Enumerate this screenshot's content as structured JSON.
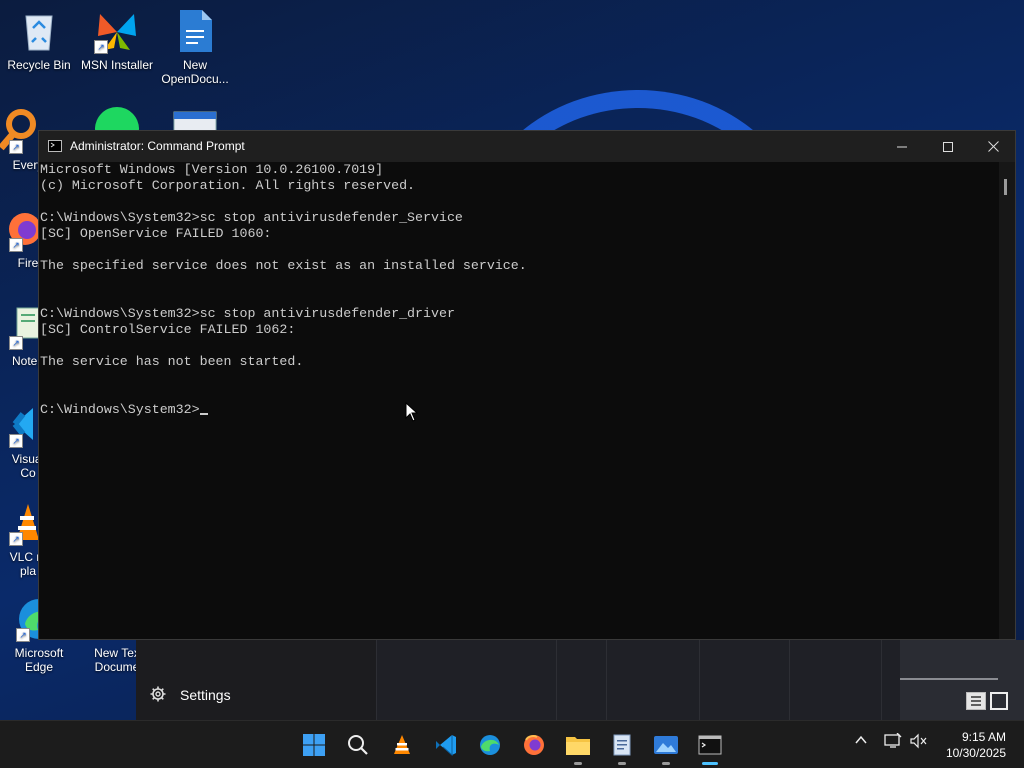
{
  "desktop": {
    "icons": [
      {
        "label": "Recycle Bin"
      },
      {
        "label": "MSN Installer"
      },
      {
        "label": "New\nOpenDocu..."
      },
      {
        "label": "Every"
      },
      {
        "label": "Fire"
      },
      {
        "label": "Notep"
      },
      {
        "label": "Visual\nCo"
      },
      {
        "label": "VLC m\npla"
      },
      {
        "label": "Microsoft\nEdge"
      },
      {
        "label": "New Tex\nDocume"
      }
    ]
  },
  "start_menu": {
    "settings_label": "Settings"
  },
  "cmd": {
    "title": "Administrator: Command Prompt",
    "lines": [
      "Microsoft Windows [Version 10.0.26100.7019]",
      "(c) Microsoft Corporation. All rights reserved.",
      "",
      "C:\\Windows\\System32>sc stop antivirusdefender_Service",
      "[SC] OpenService FAILED 1060:",
      "",
      "The specified service does not exist as an installed service.",
      "",
      "",
      "C:\\Windows\\System32>sc stop antivirusdefender_driver",
      "[SC] ControlService FAILED 1062:",
      "",
      "The service has not been started.",
      "",
      "",
      "C:\\Windows\\System32>"
    ],
    "minimize_glyph": "—",
    "maximize_glyph": "☐",
    "close_glyph": "✕"
  },
  "taskbar": {
    "items": [
      {
        "name": "start-button",
        "icon": "windows-logo-icon"
      },
      {
        "name": "search-button",
        "icon": "search-icon"
      },
      {
        "name": "vlc-button",
        "icon": "vlc-icon"
      },
      {
        "name": "vscode-button",
        "icon": "vscode-icon"
      },
      {
        "name": "edge-button",
        "icon": "edge-icon"
      },
      {
        "name": "firefox-button",
        "icon": "firefox-icon"
      },
      {
        "name": "file-explorer-button",
        "icon": "folder-icon"
      },
      {
        "name": "notepad-button",
        "icon": "notepad-icon"
      },
      {
        "name": "photos-button",
        "icon": "photos-icon"
      },
      {
        "name": "terminal-button",
        "icon": "terminal-icon"
      }
    ],
    "time": "9:15 AM",
    "date": "10/30/2025"
  },
  "colors": {
    "console_bg": "#0c0c0c",
    "console_fg": "#cccccc",
    "accent": "#4cc2ff"
  }
}
